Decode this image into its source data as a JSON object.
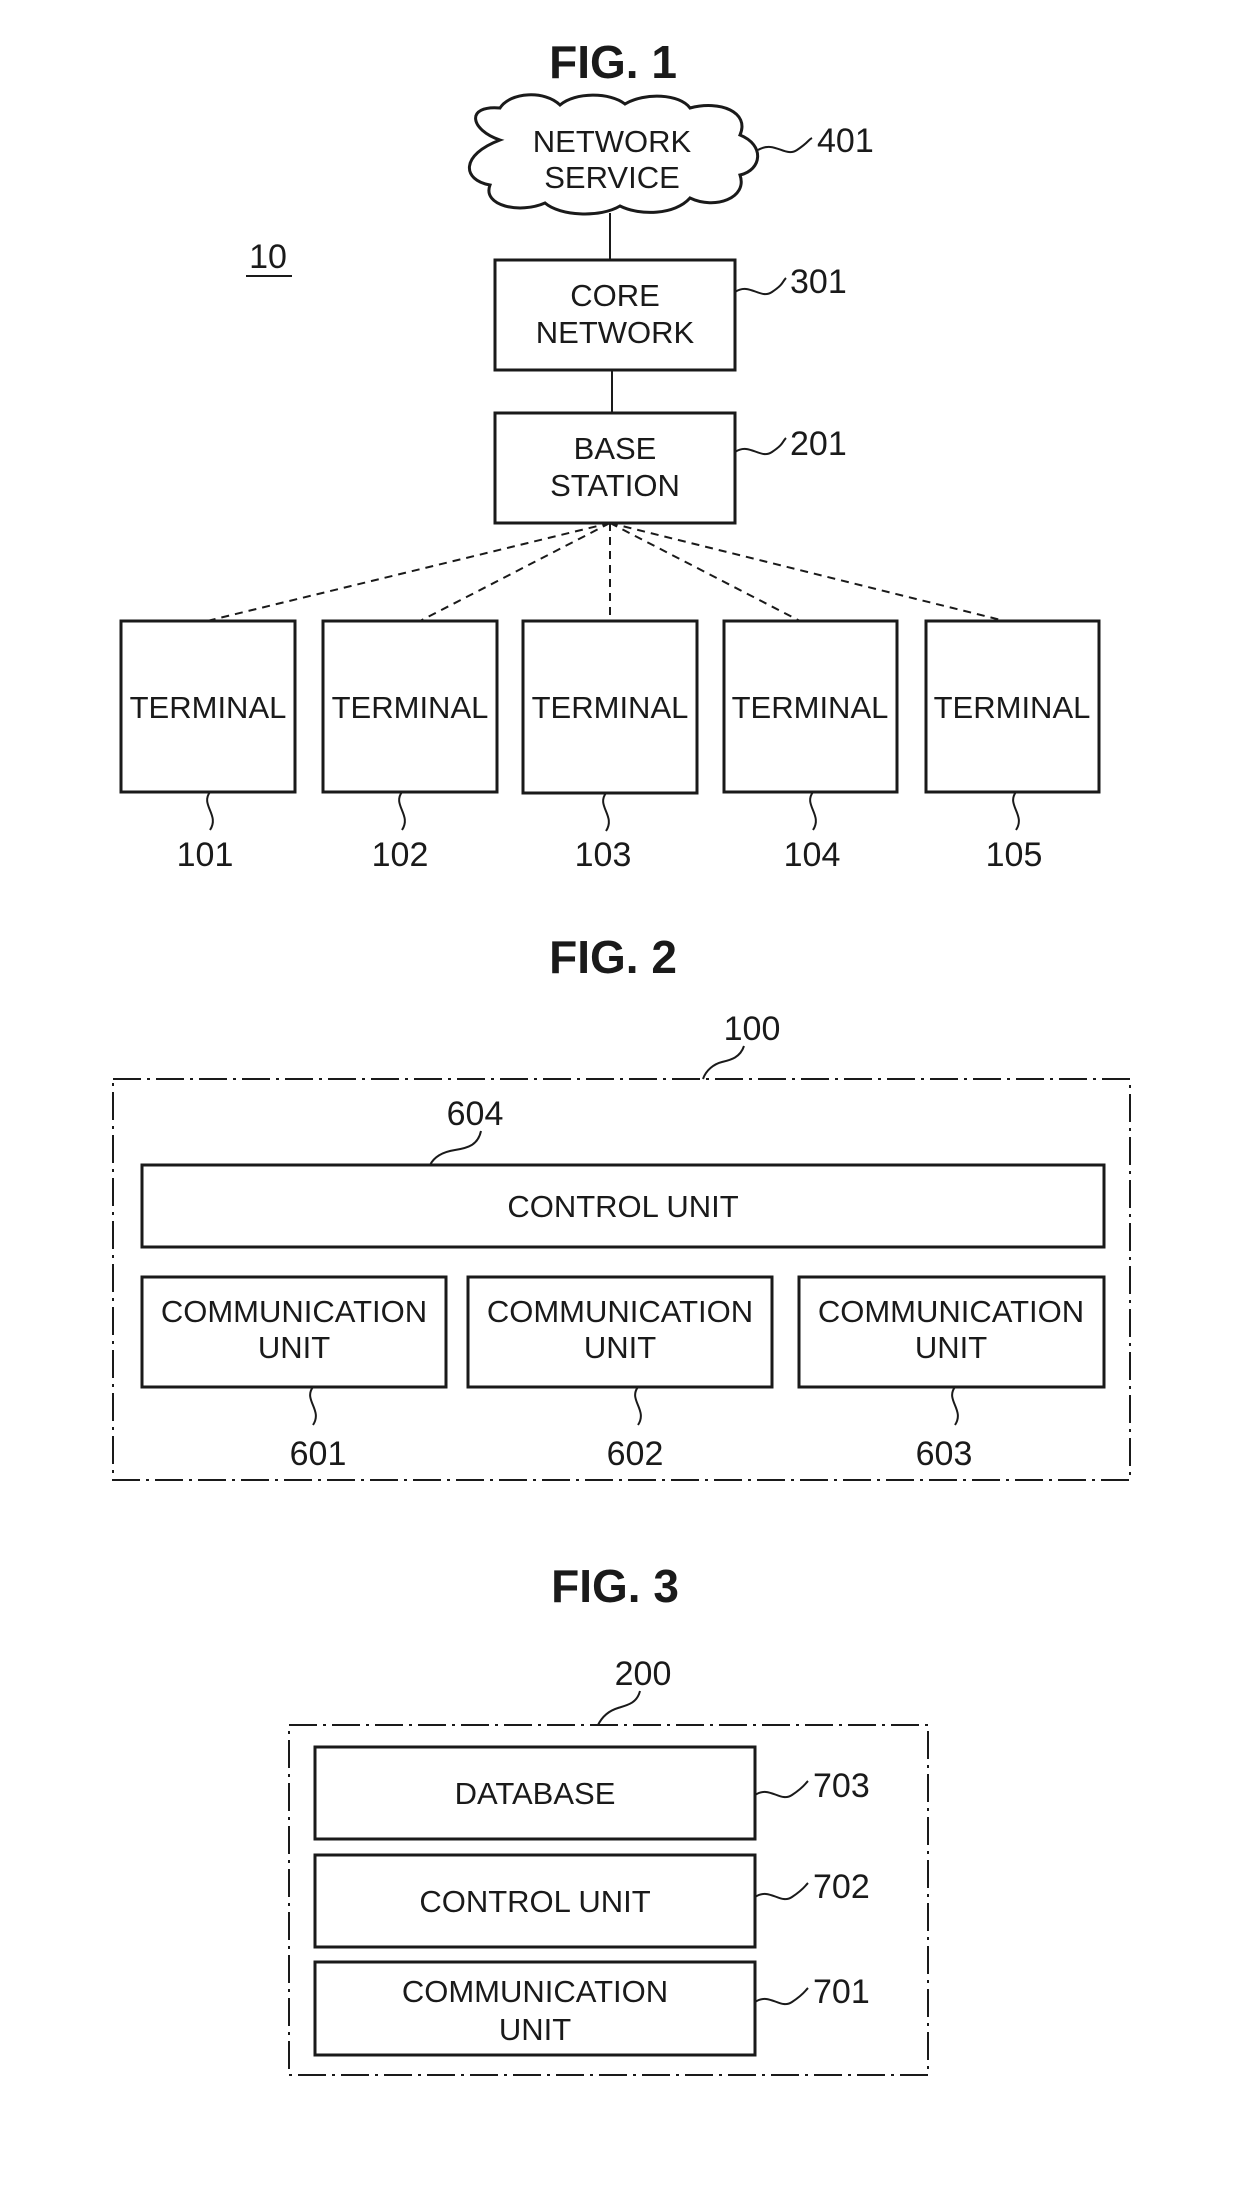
{
  "fig1": {
    "title": "FIG. 1",
    "system_ref": "10",
    "network_service": {
      "line1": "NETWORK",
      "line2": "SERVICE",
      "ref": "401"
    },
    "core_network": {
      "line1": "CORE",
      "line2": "NETWORK",
      "ref": "301"
    },
    "base_station": {
      "line1": "BASE",
      "line2": "STATION",
      "ref": "201"
    },
    "terminals": [
      {
        "label": "TERMINAL",
        "ref": "101"
      },
      {
        "label": "TERMINAL",
        "ref": "102"
      },
      {
        "label": "TERMINAL",
        "ref": "103"
      },
      {
        "label": "TERMINAL",
        "ref": "104"
      },
      {
        "label": "TERMINAL",
        "ref": "105"
      }
    ]
  },
  "fig2": {
    "title": "FIG. 2",
    "device_ref": "100",
    "control_unit": {
      "label": "CONTROL UNIT",
      "ref": "604"
    },
    "communication_units": [
      {
        "line1": "COMMUNICATION",
        "line2": "UNIT",
        "ref": "601"
      },
      {
        "line1": "COMMUNICATION",
        "line2": "UNIT",
        "ref": "602"
      },
      {
        "line1": "COMMUNICATION",
        "line2": "UNIT",
        "ref": "603"
      }
    ]
  },
  "fig3": {
    "title": "FIG. 3",
    "device_ref": "200",
    "database": {
      "label": "DATABASE",
      "ref": "703"
    },
    "control_unit": {
      "label": "CONTROL UNIT",
      "ref": "702"
    },
    "communication_unit": {
      "line1": "COMMUNICATION",
      "line2": "UNIT",
      "ref": "701"
    }
  }
}
